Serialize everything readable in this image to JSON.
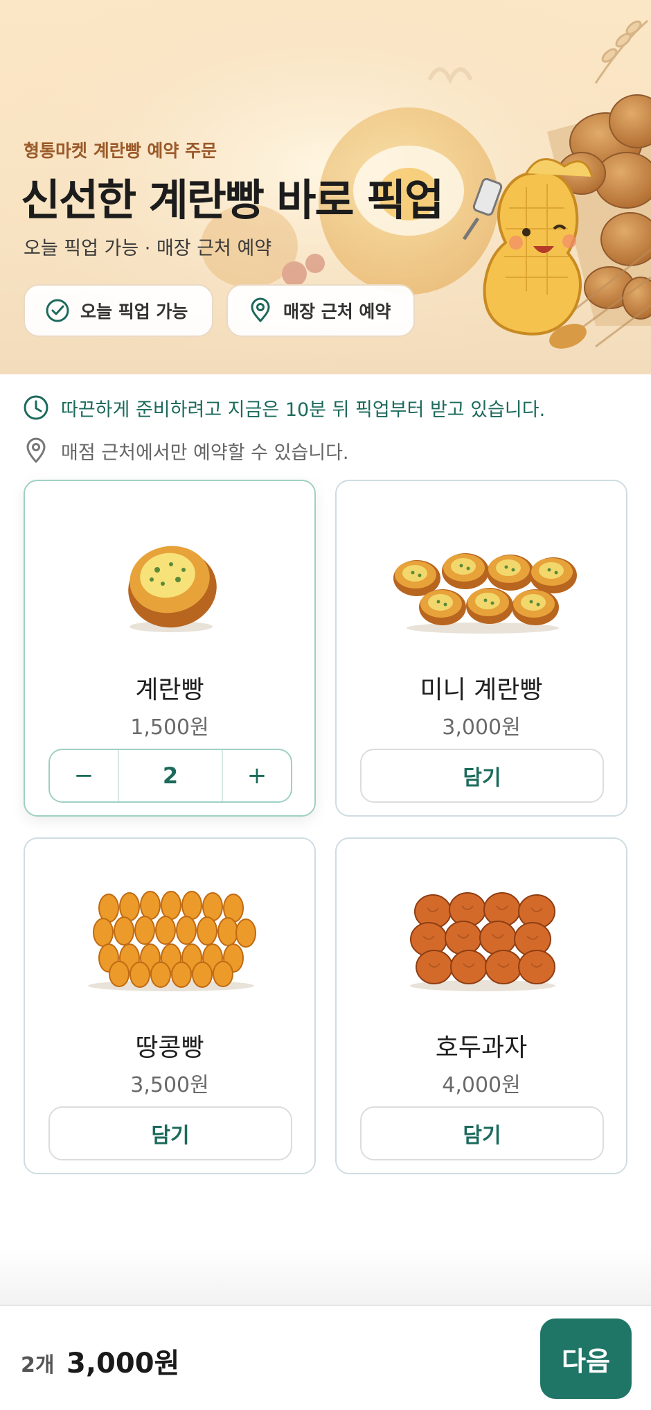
{
  "hero": {
    "eyebrow": "형통마켓 계란빵 예약 주문",
    "title": "신선한 계란빵 바로 픽업",
    "subtitle": "오늘 픽업 가능 · 매장 근처 예약",
    "chips": [
      {
        "label": "오늘 픽업 가능",
        "icon": "check-circle-icon"
      },
      {
        "label": "매장 근처 예약",
        "icon": "location-pin-icon"
      }
    ]
  },
  "info": {
    "pickup_notice": "따끈하게 준비하려고 지금은 10분 뒤 픽업부터 받고 있습니다.",
    "location_notice": "매점 근처에서만 예약할 수 있습니다."
  },
  "products": [
    {
      "name": "계란빵",
      "price": "1,500원",
      "quantity": "2",
      "selected": true
    },
    {
      "name": "미니 계란빵",
      "price": "3,000원",
      "button": "담기"
    },
    {
      "name": "땅콩빵",
      "price": "3,500원",
      "button": "담기"
    },
    {
      "name": "호두과자",
      "price": "4,000원",
      "button": "담기"
    }
  ],
  "stepper": {
    "minus": "−",
    "plus": "+"
  },
  "footer": {
    "count": "2개",
    "total": "3,000원",
    "next": "다음"
  },
  "colors": {
    "accent": "#1f7566",
    "accent_text": "#1c6a5c",
    "eyebrow": "#9a5a2a",
    "hero_bg": "#fbe6c5"
  }
}
